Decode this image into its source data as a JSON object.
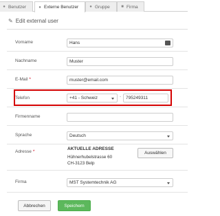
{
  "tabs": [
    {
      "label": "Benutzer",
      "icon": "user-icon"
    },
    {
      "label": "Externe Benutzer",
      "icon": "user-icon"
    },
    {
      "label": "Gruppe",
      "icon": "group-icon"
    },
    {
      "label": "Firma",
      "icon": "building-icon"
    }
  ],
  "page": {
    "title": "Edit external user",
    "icon": "pencil-icon"
  },
  "form": {
    "vorname": {
      "label": "Vorname",
      "value": "Hans"
    },
    "nachname": {
      "label": "Nachname",
      "value": "Muster"
    },
    "email": {
      "label": "E-Mail",
      "required": "*",
      "value": "muster@email.com"
    },
    "telefon": {
      "label": "Telefon",
      "country": "+41 - Schweiz",
      "separator": "-",
      "number": "795249311"
    },
    "firmenname": {
      "label": "Firmenname",
      "value": ""
    },
    "sprache": {
      "label": "Sprache",
      "value": "Deutsch"
    },
    "adresse": {
      "label": "Adresse",
      "required": "*",
      "title": "AKTUELLE ADRESSE",
      "street": "Hühnerhubelstrasse 60",
      "city": "CH-3123 Belp",
      "button": "Auswählen"
    },
    "firma": {
      "label": "Firma",
      "value": "MST Systemtechnik AG"
    }
  },
  "actions": {
    "cancel": "Abbrechen",
    "save": "Speichern"
  },
  "colors": {
    "highlight": "#d40000",
    "save": "#5cb85c",
    "required": "#d0021b"
  }
}
